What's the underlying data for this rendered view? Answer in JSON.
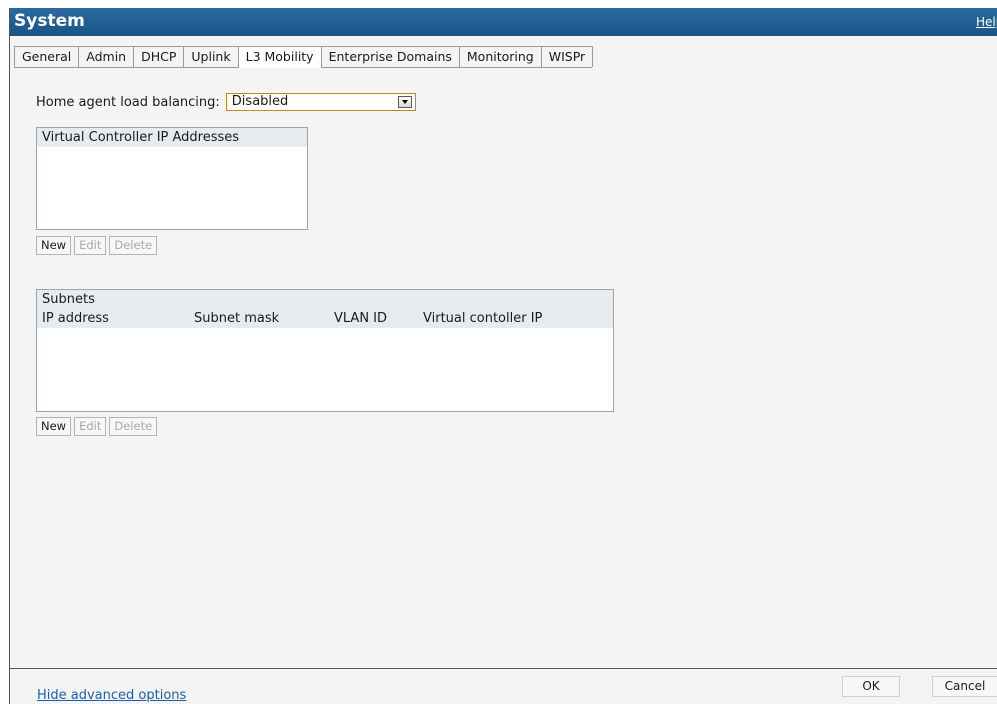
{
  "window": {
    "title": "System",
    "help_label": "Help"
  },
  "tabs": [
    {
      "label": "General"
    },
    {
      "label": "Admin"
    },
    {
      "label": "DHCP"
    },
    {
      "label": "Uplink"
    },
    {
      "label": "L3 Mobility"
    },
    {
      "label": "Enterprise Domains"
    },
    {
      "label": "Monitoring"
    },
    {
      "label": "WISPr"
    }
  ],
  "active_tab": "L3 Mobility",
  "home_agent": {
    "label": "Home agent load balancing:",
    "selected": "Disabled"
  },
  "vc_panel": {
    "header": "Virtual Controller IP Addresses",
    "buttons": {
      "new": "New",
      "edit": "Edit",
      "delete": "Delete"
    }
  },
  "subnets_panel": {
    "header": "Subnets",
    "columns": [
      "IP address",
      "Subnet mask",
      "VLAN ID",
      "Virtual contoller IP"
    ],
    "buttons": {
      "new": "New",
      "edit": "Edit",
      "delete": "Delete"
    }
  },
  "footer": {
    "advanced_link": "Hide advanced options",
    "ok": "OK",
    "cancel": "Cancel"
  },
  "colors": {
    "titlebar": "#1a5486",
    "accent_border": "#c28a1e",
    "link": "#1f5ea8"
  }
}
